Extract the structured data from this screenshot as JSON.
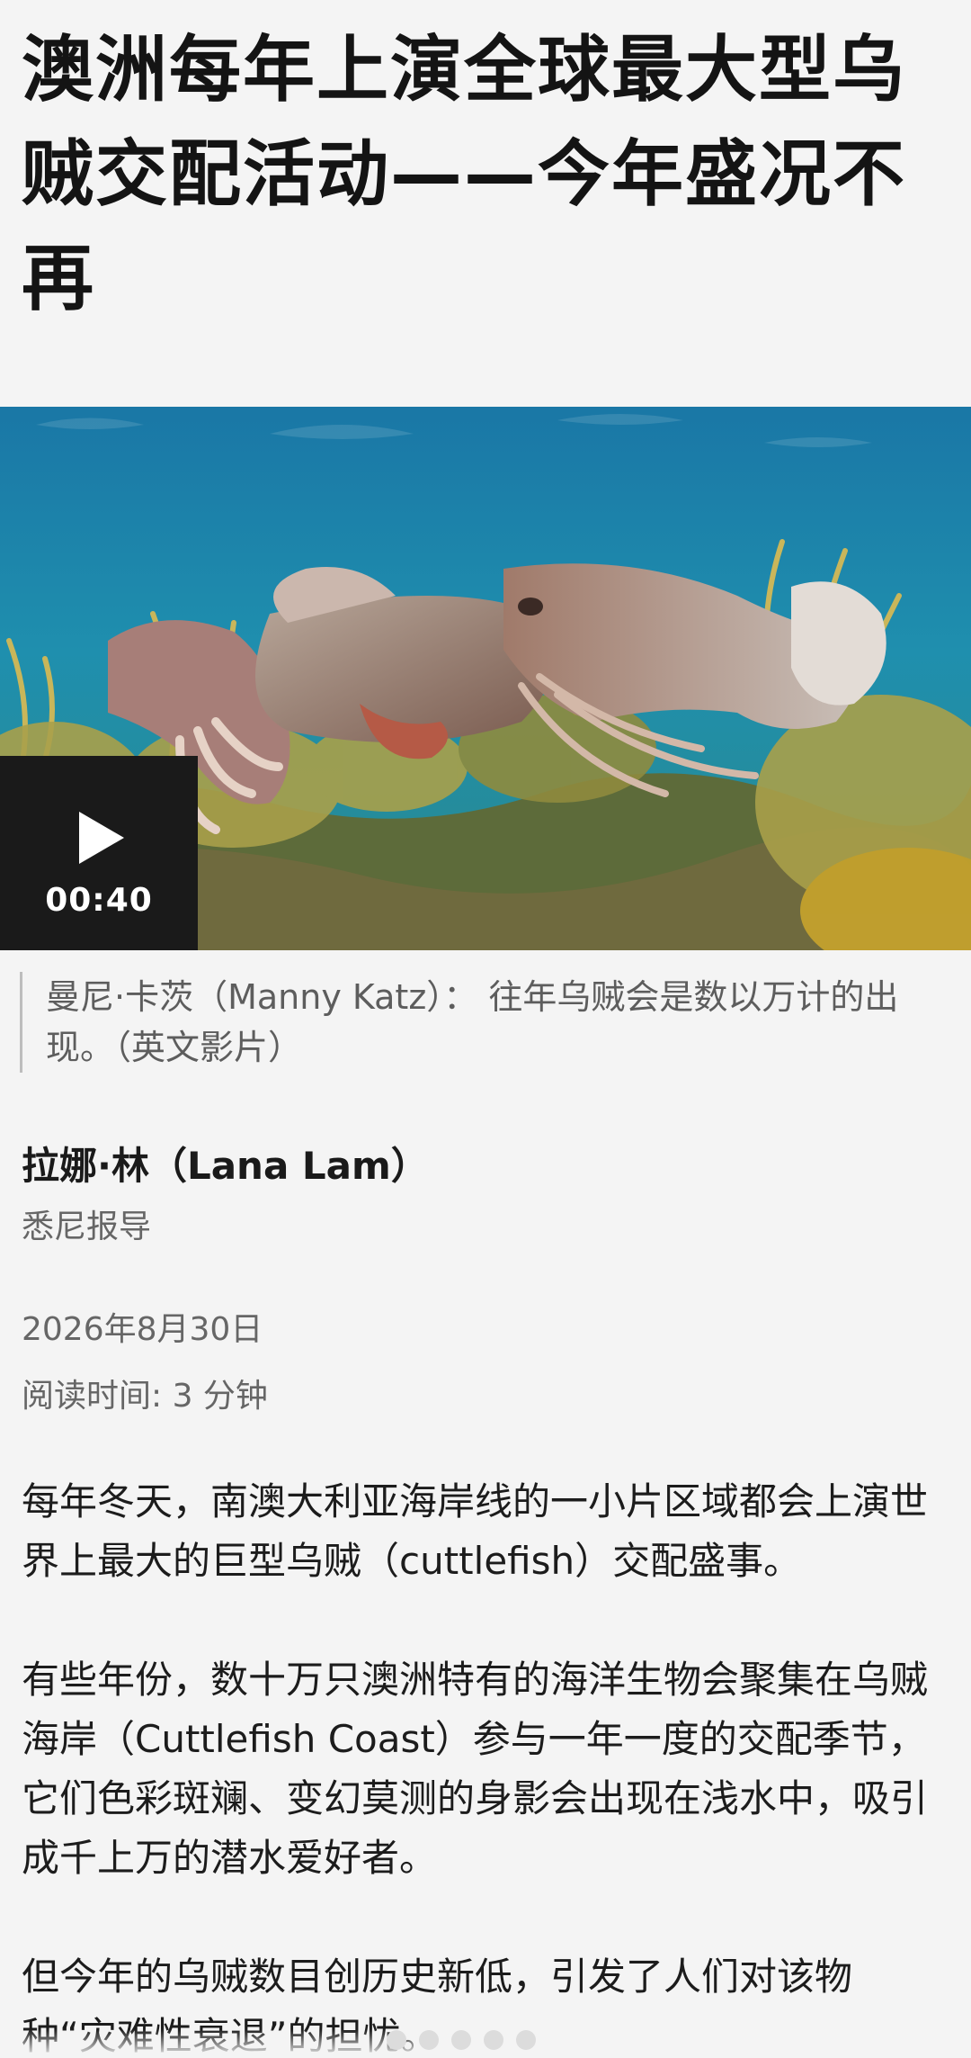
{
  "article": {
    "headline": "澳洲每年上演全球最大型乌贼交配活动——今年盛况不再",
    "video": {
      "duration": "00:40",
      "play_icon": "play-icon"
    },
    "image_caption": "曼尼·卡茨（Manny Katz）： 往年乌贼会是数以万计的出现。（英文影片）",
    "author": "拉娜·林（Lana Lam）",
    "dateline": "悉尼报导",
    "date": "2026年8月30日",
    "read_time": "阅读时间: 3 分钟",
    "paragraphs": [
      "每年冬天，南澳大利亚海岸线的一小片区域都会上演世界上最大的巨型乌贼（cuttlefish）交配盛事。",
      "有些年份，数十万只澳洲特有的海洋生物会聚集在乌贼海岸（Cuttlefish Coast）参与一年一度的交配季节，它们色彩斑斓、变幻莫测的身影会出现在浅水中，吸引成千上万的潜水爱好者。",
      "但今年的乌贼数目创历史新低，引发了人们对该物种“灾难性衰退”的担忧。"
    ]
  },
  "colors": {
    "background": "#f4f4f4",
    "headline": "#141414",
    "meta_text": "#666666",
    "video_badge": "#1a1a1a"
  }
}
